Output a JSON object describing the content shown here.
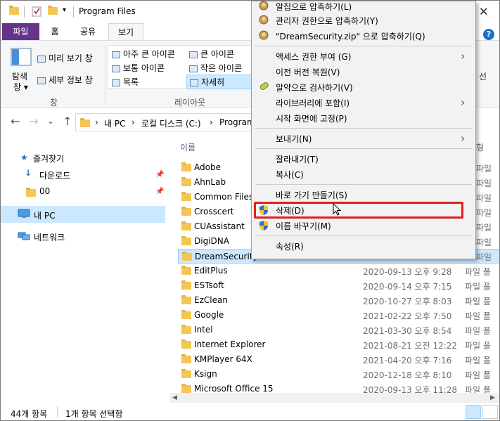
{
  "window": {
    "title": "Program Files",
    "close_glyph": "✕",
    "help_glyph": "?"
  },
  "ribbon": {
    "tabs": [
      {
        "label": "파일"
      },
      {
        "label": "홈"
      },
      {
        "label": "공유"
      },
      {
        "label": "보기"
      }
    ],
    "pane_group": {
      "nav_pane_label_1": "탐색",
      "nav_pane_label_2": "창 ▾",
      "preview_pane": "미리 보기 창",
      "details_pane": "세부 정보 창",
      "group_label": "창"
    },
    "layout_group": {
      "extra_large": "아주 큰 아이콘",
      "large": "큰 아이콘",
      "medium": "보통 아이콘",
      "small": "작은 아이콘",
      "list": "목록",
      "details": "자세히",
      "group_label": "레이아웃"
    },
    "right_partial": "선"
  },
  "address": {
    "back": "←",
    "forward": "→",
    "recent": "⌄",
    "up": "↑",
    "crumbs": [
      "내 PC",
      "로컬 디스크 (C:)",
      "Program"
    ],
    "separator": "›"
  },
  "nav_pane": {
    "quick_access": "즐겨찾기",
    "downloads": "다운로드",
    "folder_00": "00",
    "this_pc": "내 PC",
    "network": "네트워크"
  },
  "file_list": {
    "column_name": "이름",
    "column_right_partial": "형",
    "files": [
      {
        "name": "Adobe",
        "date": "",
        "type": ""
      },
      {
        "name": "AhnLab",
        "date": "",
        "type": ""
      },
      {
        "name": "Common Files",
        "date": "",
        "type": ""
      },
      {
        "name": "Crosscert",
        "date": "",
        "type": ""
      },
      {
        "name": "CUAssistant",
        "date": "",
        "type": ""
      },
      {
        "name": "DigiDNA",
        "date": "",
        "type": ""
      },
      {
        "name": "DreamSecurity",
        "date": "",
        "type": ""
      },
      {
        "name": "EditPlus",
        "date": "2020-09-13 오후 9:28",
        "type": "파일 폴"
      },
      {
        "name": "ESTsoft",
        "date": "2020-09-14 오후 7:15",
        "type": "파일 폴"
      },
      {
        "name": "EzClean",
        "date": "2020-10-27 오후 8:03",
        "type": "파일 폴"
      },
      {
        "name": "Google",
        "date": "2021-02-22 오후 7:50",
        "type": "파일 폴"
      },
      {
        "name": "Intel",
        "date": "2021-03-30 오후 8:54",
        "type": "파일 폴"
      },
      {
        "name": "Internet Explorer",
        "date": "2021-08-21 오전 12:22",
        "type": "파일 폴"
      },
      {
        "name": "KMPlayer 64X",
        "date": "2021-04-20 오후 7:16",
        "type": "파일 폴"
      },
      {
        "name": "Ksign",
        "date": "2020-12-18 오후 8:10",
        "type": "파일 폴"
      },
      {
        "name": "Microsoft Office 15",
        "date": "2020-09-13 오후 11:28",
        "type": "파일 폴"
      }
    ],
    "right_column_partial": [
      "파일",
      "파일",
      "파일",
      "파일",
      "파일",
      "파일",
      "파일"
    ]
  },
  "context_menu": {
    "items": [
      {
        "label": "알집으로 압축하기(L)"
      },
      {
        "label": "관리자 권한으로 압축하기(Y)"
      },
      {
        "label": "\"DreamSecurity.zip\" 으로 압축하기(Q)"
      },
      {
        "label": "액세스 권한 부여 (G)"
      },
      {
        "label": "이전 버전 복원(V)"
      },
      {
        "label": "알약으로 검사하기(V)"
      },
      {
        "label": "라이브러리에 포함(I)"
      },
      {
        "label": "시작 화면에 고정(P)"
      },
      {
        "label": "보내기(N)"
      },
      {
        "label": "잘라내기(T)"
      },
      {
        "label": "복사(C)"
      },
      {
        "label": "바로 가기 만들기(S)"
      },
      {
        "label": "삭제(D)"
      },
      {
        "label": "이름 바꾸기(M)"
      },
      {
        "label": "속성(R)"
      }
    ],
    "submenu_arrow": "›"
  },
  "status": {
    "item_count": "44개 항목",
    "selected": "1개 항목 선택함"
  },
  "colors": {
    "file_tab": "#64338c",
    "selection": "#cce8ff",
    "highlight_border": "#e02020",
    "folder": "#f3c655"
  }
}
